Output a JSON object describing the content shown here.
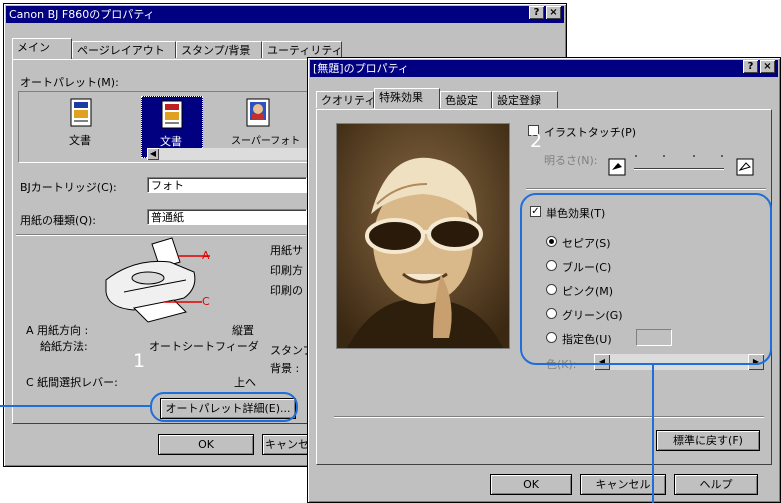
{
  "back_window": {
    "title": "Canon BJ F860のプロパティ",
    "tabs": [
      "メイン",
      "ページレイアウト",
      "スタンプ/背景",
      "ユーティリティ"
    ],
    "auto_palette_label": "オートパレット(M):",
    "palette_items": [
      "文書",
      "文書",
      "スーパーフォト"
    ],
    "cartridge_label": "BJカートリッジ(C):",
    "cartridge_value": "フォト",
    "paper_label": "用紙の種類(Q):",
    "paper_value": "普通紙",
    "marker_a": "A",
    "marker_c": "C",
    "info_right": [
      "用紙サ",
      "印刷方",
      "印刷の"
    ],
    "paper_dir_label": "A 用紙方向 :",
    "paper_dir_value": "縦置",
    "feed_label": "給紙方法:",
    "feed_value": "オートシートフィーダ",
    "lever_label": "C 紙間選択レバー:",
    "lever_value": "上へ",
    "stamp_label": "スタンプ",
    "bg_label": "背景 :",
    "auto_palette_detail_button": "オートパレット詳細(E)...",
    "ok_button": "OK",
    "cancel_button": "キャンセ"
  },
  "front_window": {
    "title": "[無題]のプロパティ",
    "tabs": [
      "クオリティ",
      "特殊効果",
      "色設定",
      "設定登録"
    ],
    "illust_touch_label": "イラストタッチ(P)",
    "brightness_label": "明るさ(N):",
    "mono_effect_label": "単色効果(T)",
    "radios": [
      "セピア(S)",
      "ブルー(C)",
      "ピンク(M)",
      "グリーン(G)",
      "指定色(U)"
    ],
    "color_label": "色(K):",
    "restore_button": "標準に戻す(F)",
    "ok_button": "OK",
    "cancel_button": "キャンセル",
    "help_button": "ヘルプ"
  },
  "callouts": {
    "one": "1",
    "two": "2"
  },
  "colors": {
    "title_bar": "#000080",
    "window_face": "#c0c0c0",
    "callout_line": "#1e6fd9",
    "sepia_dark": "#5a3c1c",
    "sepia_light": "#d9b98a"
  }
}
